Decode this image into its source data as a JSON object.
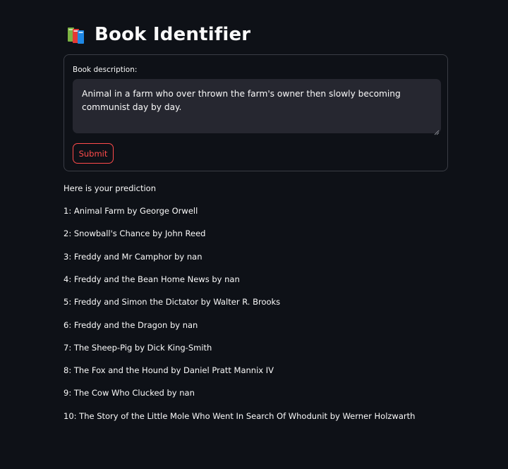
{
  "app": {
    "title": "Book Identifier",
    "title_icon": "books-icon"
  },
  "form": {
    "label": "Book description:",
    "value": "Animal in a farm who over thrown the farm's owner then slowly becoming communist day by day.",
    "submit_label": "Submit"
  },
  "results": {
    "intro": "Here is your prediction",
    "predictions": [
      "1: Animal Farm by George Orwell",
      "2: Snowball's Chance by John Reed",
      "3: Freddy and Mr Camphor by nan",
      "4: Freddy and the Bean Home News by nan",
      "5: Freddy and Simon the Dictator by Walter R. Brooks",
      "6: Freddy and the Dragon by nan",
      "7: The Sheep-Pig by Dick King-Smith",
      "8: The Fox and the Hound by Daniel Pratt Mannix IV",
      "9: The Cow Who Clucked by nan",
      "10: The Story of the Little Mole Who Went In Search Of Whodunit by Werner Holzwarth"
    ]
  },
  "colors": {
    "background": "#0e1117",
    "input_background": "#262730",
    "accent": "#ff4b4b",
    "text": "#fafafa",
    "border": "#3a3d45"
  }
}
